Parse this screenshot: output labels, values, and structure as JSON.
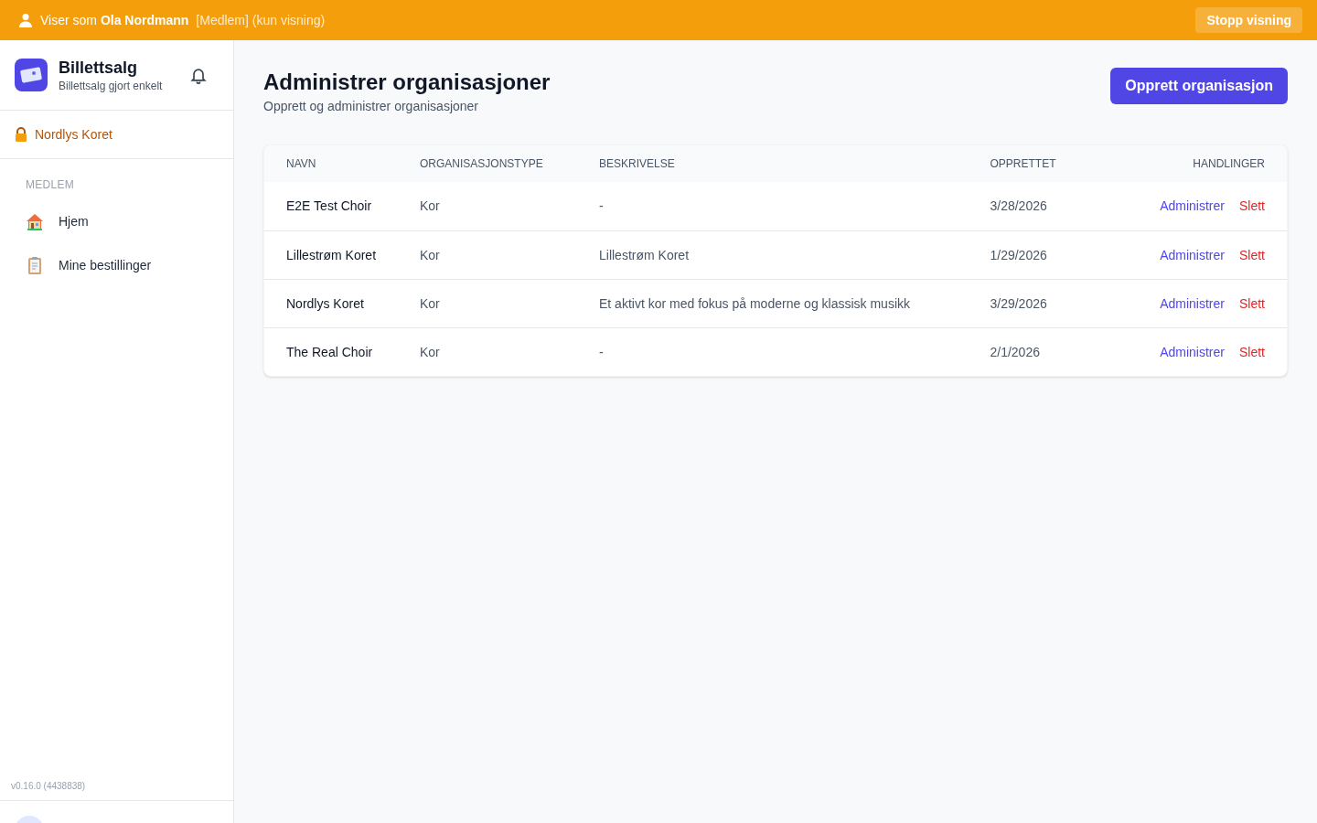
{
  "banner": {
    "text": "Viser som **Ola Nordmann**",
    "role": "[Medlem] (kun visning)",
    "button": "Stopp visning"
  },
  "sidebar": {
    "app_name": "Billettsalg",
    "tagline": "Billettsalg gjort enkelt",
    "organization": "Nordlys Koret",
    "section": "MEDLEM",
    "items": [
      {
        "label": "Hjem",
        "kind": "home"
      },
      {
        "label": "Mine bestillinger",
        "kind": "orders"
      }
    ],
    "version": "v0.16.0 (4438838)"
  },
  "page": {
    "title": "Administrer organisasjoner",
    "subtitle": "Opprett og administrer organisasjoner",
    "create_button": "Opprett organisasjon"
  },
  "table": {
    "columns": [
      "NAVN",
      "ORGANISASJONSTYPE",
      "BESKRIVELSE",
      "OPPRETTET",
      "HANDLINGER"
    ],
    "rows": [
      {
        "name": "E2E Test Choir",
        "type": "Kor",
        "description": "-",
        "created": "3/28/2026",
        "actions": [
          "Administrer",
          "Slett"
        ]
      },
      {
        "name": "Lillestrøm Koret",
        "type": "Kor",
        "description": "Lillestrøm Koret",
        "created": "1/29/2026",
        "actions": [
          "Administrer",
          "Slett"
        ]
      },
      {
        "name": "Nordlys Koret",
        "type": "Kor",
        "description": "Et aktivt kor med fokus på moderne og klassisk musikk",
        "created": "3/29/2026",
        "actions": [
          "Administrer",
          "Slett"
        ]
      },
      {
        "name": "The Real Choir",
        "type": "Kor",
        "description": "-",
        "created": "2/1/2026",
        "actions": [
          "Administrer",
          "Slett"
        ]
      }
    ]
  }
}
